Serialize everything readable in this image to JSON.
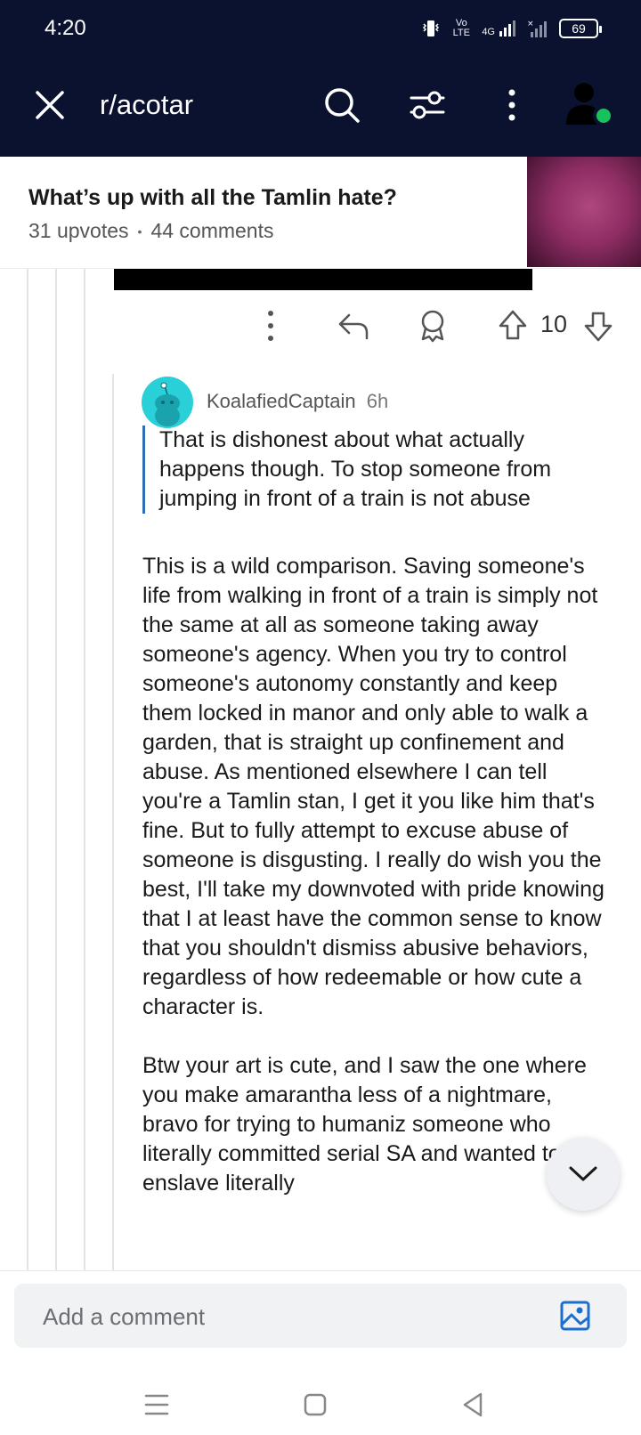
{
  "status_bar": {
    "time": "4:20",
    "indicators": [
      "vibrate-icon",
      "volte-icon",
      "4g-signal-icon",
      "no-signal-icon"
    ],
    "volte_label": "Vo LTE",
    "network_label": "4G",
    "battery": "69"
  },
  "app_bar": {
    "subreddit": "r/acotar"
  },
  "post": {
    "title": "What’s up with all the Tamlin hate?",
    "upvotes": "31 upvotes",
    "separator": "•",
    "comments": "44 comments"
  },
  "parent_actions": {
    "vote_count": "10"
  },
  "comment": {
    "username": "KoalafiedCaptain",
    "age": "6h",
    "quote": "That is dishonest about what actually happens though. To stop someone from jumping in front of a train is not abuse",
    "paragraphs": [
      "This is a wild comparison. Saving someone's life from walking in front of a train is simply not the same at all as someone taking away someone's agency. When you try to control someone's autonomy constantly and keep them locked in manor and only able to walk a garden, that is straight up confinement and abuse. As mentioned elsewhere I can tell you're a Tamlin stan, I get it you like him that's fine. But to fully attempt to excuse abuse of someone is disgusting. I really do wish you the best, I'll take my downvoted with pride knowing that I at least have the common sense to know that you shouldn't dismiss abusive behaviors, regardless of how redeemable or how cute a character is.",
      "Btw your art is cute, and I saw the one where you make amarantha less of a nightmare, bravo for trying to humaniz someone who literally committed serial SA and wanted to enslave literally"
    ]
  },
  "comment_bar": {
    "placeholder": "Add a comment"
  },
  "colors": {
    "header_bg": "#0b1230",
    "online": "#18c25a",
    "quote_bar": "#2e6eb5",
    "avatar_bg": "#2ad0d8",
    "image_icon": "#1b6fd1"
  }
}
